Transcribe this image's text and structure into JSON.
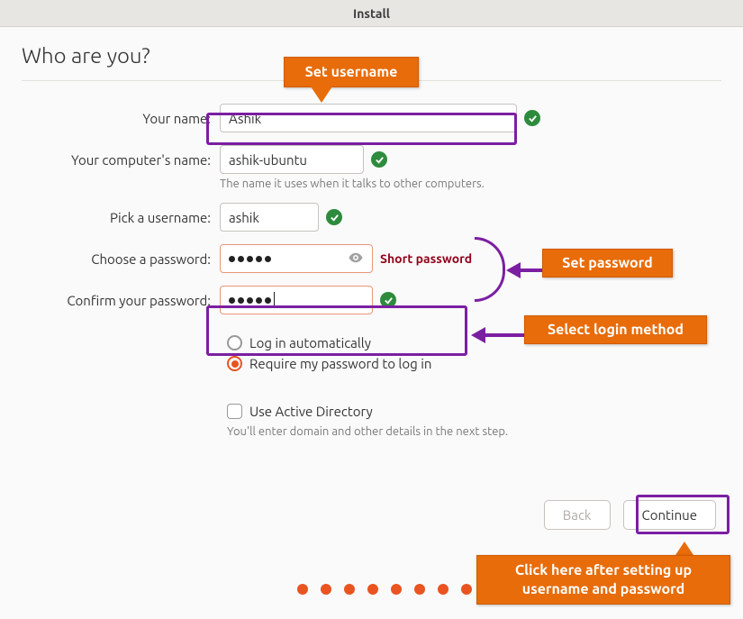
{
  "window": {
    "title": "Install"
  },
  "heading": "Who are you?",
  "form": {
    "name_label": "Your name:",
    "name_value": "Ashik",
    "computer_label": "Your computer's name:",
    "computer_value": "ashik-ubuntu",
    "computer_hint": "The name it uses when it talks to other computers.",
    "username_label": "Pick a username:",
    "username_value": "ashik",
    "password_label": "Choose a password:",
    "password_masked": "●●●●●",
    "password_hint": "Short password",
    "confirm_label": "Confirm your password:",
    "confirm_masked": "●●●●●",
    "option_auto": "Log in automatically",
    "option_require": "Require my password to log in",
    "use_ad": "Use Active Directory",
    "ad_hint": "You'll enter domain and other details in the next step."
  },
  "buttons": {
    "back": "Back",
    "continue": "Continue"
  },
  "annotations": {
    "set_username": "Set username",
    "set_password": "Set password",
    "select_login": "Select login method",
    "click_continue": "Click here after setting up username and password"
  },
  "colors": {
    "accent": "#e95420",
    "annotation_border": "#7b1fa2",
    "callout_bg": "#e86c0a",
    "success": "#2e8b3d",
    "error_text": "#92001a"
  },
  "progress": {
    "total_dots": 8
  }
}
